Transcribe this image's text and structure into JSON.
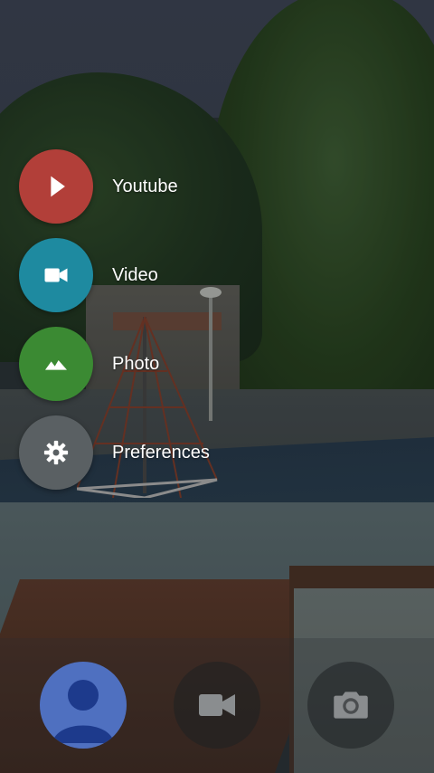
{
  "menu": {
    "items": [
      {
        "label": "Youtube",
        "icon": "play-icon",
        "color": "#b23f39"
      },
      {
        "label": "Video",
        "icon": "videocam-icon",
        "color": "#1e8aa0"
      },
      {
        "label": "Photo",
        "icon": "landscape-icon",
        "color": "#3b8a33"
      },
      {
        "label": "Preferences",
        "icon": "gear-icon",
        "color": "#5a6063"
      }
    ]
  },
  "bottom_bar": {
    "buttons": [
      {
        "name": "profile-button",
        "icon": "account-icon",
        "color": "#4f70c0"
      },
      {
        "name": "video-record-button",
        "icon": "videocam-icon"
      },
      {
        "name": "camera-capture-button",
        "icon": "camera-icon"
      }
    ]
  }
}
